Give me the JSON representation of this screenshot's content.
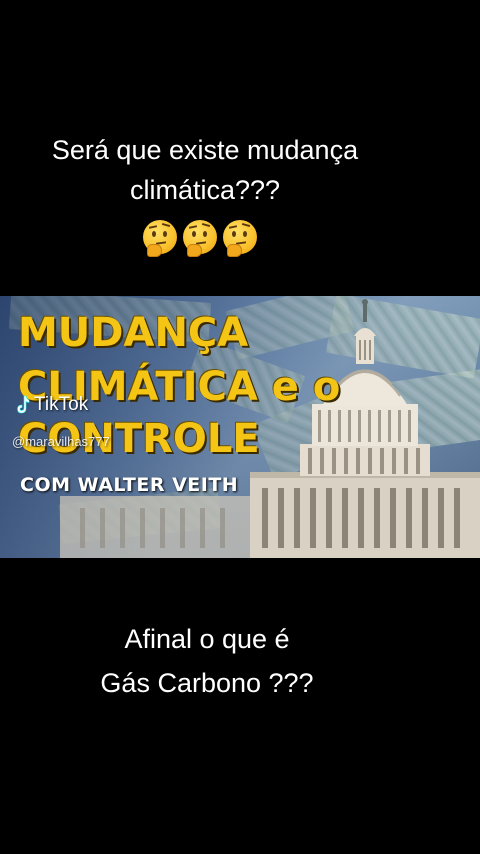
{
  "caption_top": {
    "line1": "Será que existe mudança",
    "line2": "climática???",
    "emojis": [
      "thinking-face",
      "thinking-face",
      "thinking-face"
    ]
  },
  "video": {
    "title_line1": "MUDANÇA",
    "title_line2": "CLIMÁTICA e o",
    "title_line3": "CONTROLE",
    "subtitle": "COM WALTER VEITH",
    "title_color": "#f5c516",
    "watermark": {
      "brand": "TikTok",
      "handle": "@maravilhas777"
    }
  },
  "caption_bottom": {
    "line1": "Afinal o que é",
    "line2": "Gás Carbono ???"
  }
}
